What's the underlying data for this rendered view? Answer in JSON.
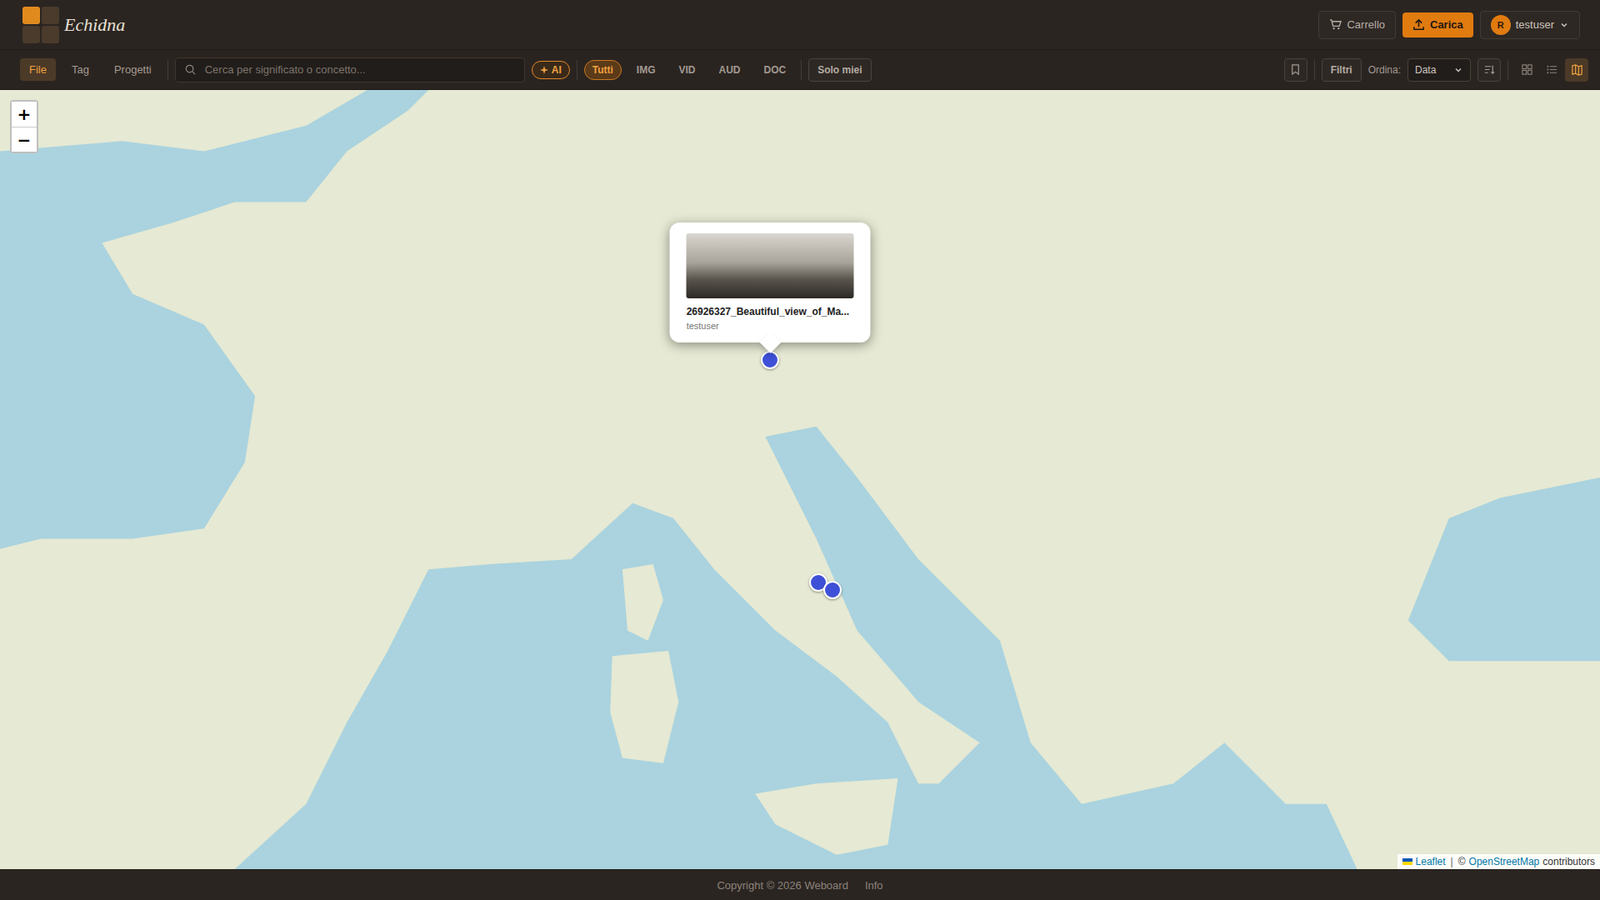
{
  "app": {
    "name": "Echidna"
  },
  "header": {
    "cart": "Carrello",
    "upload": "Carica",
    "user": {
      "initial": "R",
      "name": "testuser"
    }
  },
  "nav_tabs": [
    {
      "label": "File",
      "selected": true
    },
    {
      "label": "Tag",
      "selected": false
    },
    {
      "label": "Progetti",
      "selected": false
    }
  ],
  "search": {
    "placeholder": "Cerca per significato o concetto..."
  },
  "ai_toggle": {
    "label": "AI",
    "on": false
  },
  "type_filters": [
    {
      "label": "Tutti",
      "selected": true
    },
    {
      "label": "IMG",
      "selected": false
    },
    {
      "label": "VID",
      "selected": false
    },
    {
      "label": "AUD",
      "selected": false
    },
    {
      "label": "DOC",
      "selected": false
    }
  ],
  "only_mine": {
    "label": "Solo miei",
    "on": false
  },
  "filters_button": "Filtri",
  "sort": {
    "label": "Ordina:",
    "value": "Data"
  },
  "views": [
    {
      "kind": "grid",
      "selected": false
    },
    {
      "kind": "list",
      "selected": false
    },
    {
      "kind": "map",
      "selected": true
    }
  ],
  "map": {
    "zoom_in": "+",
    "zoom_out": "−",
    "attribution": {
      "leaflet": "Leaflet",
      "separator": "|",
      "copyright": "©",
      "osm": "OpenStreetMap",
      "suffix": "contributors"
    },
    "markers": [
      {
        "lat": 46.84,
        "lon": 12.36,
        "selected": true,
        "popup": {
          "title": "26926327_Beautiful_view_of_Ma...",
          "owner": "testuser"
        }
      },
      {
        "lat": 42.68,
        "lon": 13.63,
        "selected": false
      },
      {
        "lat": 42.54,
        "lon": 14.0,
        "selected": false
      }
    ]
  },
  "footer": {
    "copyright": "Copyright © 2026 Weboard",
    "info": "Info"
  }
}
